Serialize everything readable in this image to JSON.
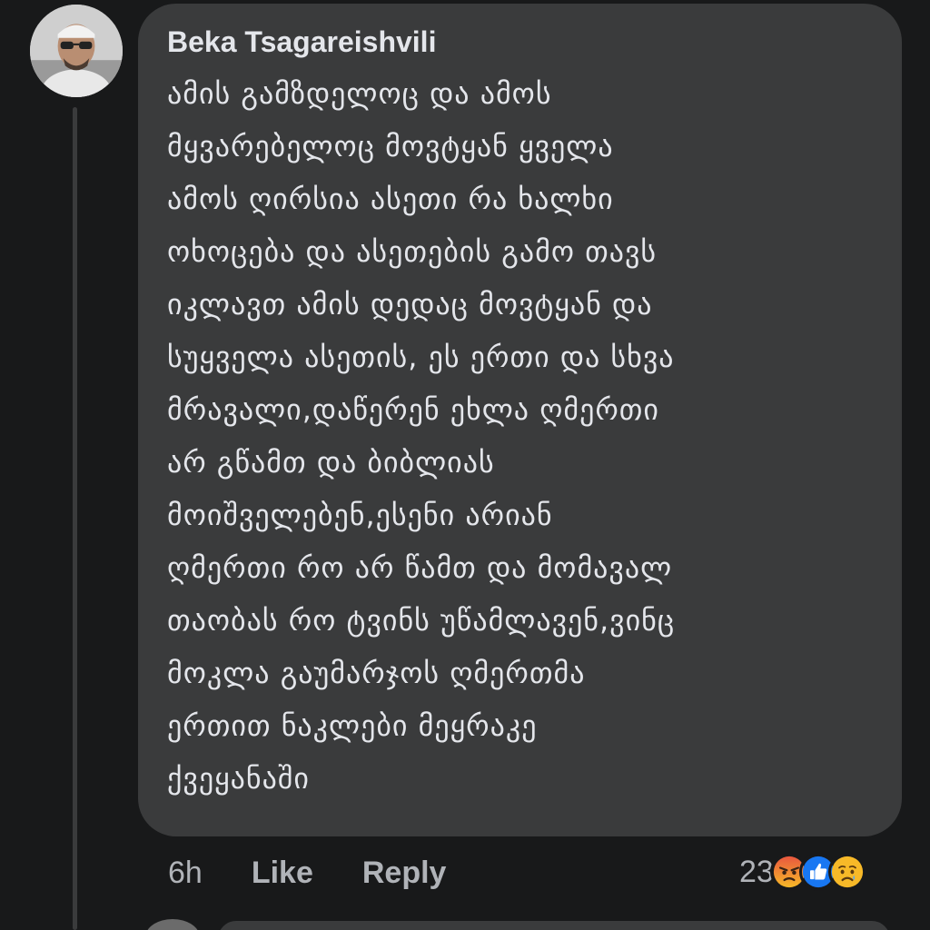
{
  "comment": {
    "author": "Beka Tsagareishvili",
    "text_lines": [
      "ამის გამზდელოც და ამოს",
      "მყვარებელოც მოვტყან ყველა",
      "ამოს ღირსია ასეთი რა ხალხი",
      "ოხოცება და ასეთების გამო თავს",
      "იკლავთ ამის დედაც მოვტყან და",
      "სუყველა ასეთის, ეს ერთი და სხვა",
      "მრავალი,დაწერენ ეხლა ღმერთი",
      "არ გწამთ და ბიბლიას",
      "მოიშველებენ,ესენი არიან",
      "ღმერთი რო არ წამთ და მომავალ",
      "თაობას რო ტვინს უწამლავენ,ვინც",
      "მოკლა გაუმარჯოს ღმერთმა",
      "ერთით ნაკლები მეყრაკე",
      "ქვეყანაში"
    ],
    "time": "6h",
    "like_label": "Like",
    "reply_label": "Reply",
    "reaction_count": "23",
    "reactions": [
      "angry-icon",
      "like-icon",
      "sad-icon"
    ]
  },
  "colors": {
    "background": "#18191a",
    "bubble": "#3a3b3c",
    "text": "#e4e6eb",
    "secondary_text": "#b0b3b8",
    "like_blue": "#1877f2",
    "angry_red": "#e9573f",
    "sad_yellow": "#f7b928"
  }
}
